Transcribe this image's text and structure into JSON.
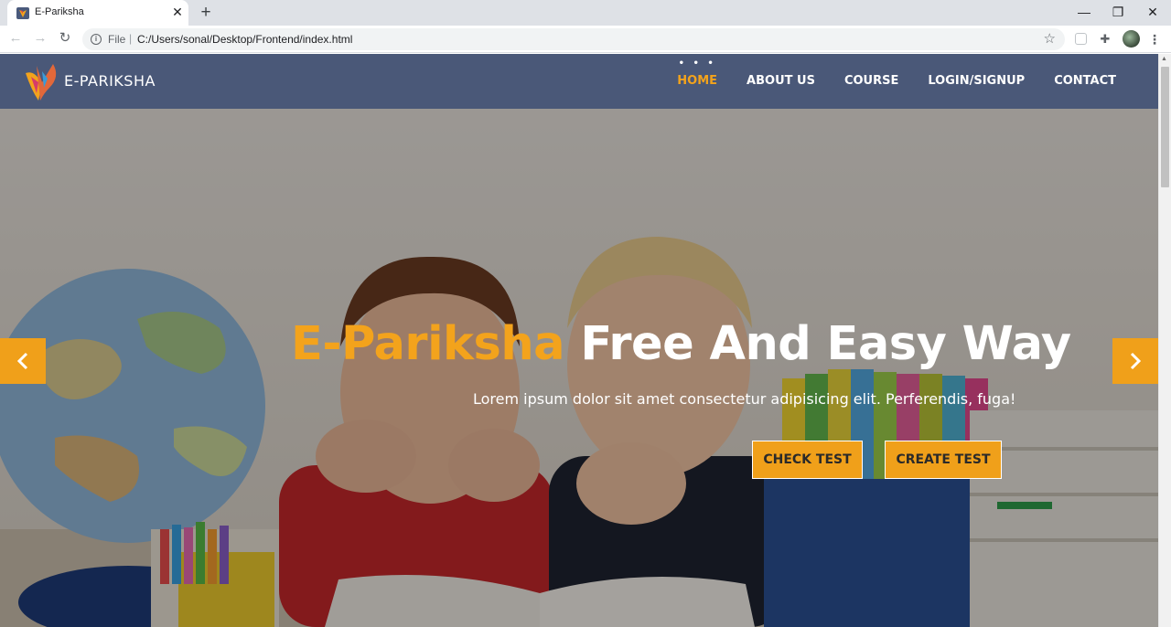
{
  "browser": {
    "tab_title": "E-Pariksha",
    "tab_close": "✕",
    "new_tab": "+",
    "window_controls": {
      "minimize": "—",
      "maximize": "❐",
      "close": "✕"
    },
    "address": {
      "scheme": "File",
      "separator": "|",
      "url": "C:/Users/sonal/Desktop/Frontend/index.html"
    },
    "icons": {
      "back": "arrow-left-icon",
      "forward": "arrow-right-icon",
      "reload": "reload-icon",
      "info": "info-icon",
      "bookmark": "star-icon",
      "extensions": "puzzle-icon",
      "menu": "menu-dots-icon"
    }
  },
  "site": {
    "logo_text": "E-PARIKSHA",
    "nav": [
      {
        "label": "HOME",
        "active": true
      },
      {
        "label": "ABOUT US",
        "active": false
      },
      {
        "label": "COURSE",
        "active": false
      },
      {
        "label": "LOGIN/SIGNUP",
        "active": false
      },
      {
        "label": "CONTACT",
        "active": false
      }
    ],
    "active_marker": "• • •"
  },
  "hero": {
    "title_brand": "E-Pariksha",
    "title_rest": "Free And Easy Way",
    "subtitle": "Lorem ipsum dolor sit amet consectetur adipisicing elit. Perferendis, fuga!",
    "buttons": {
      "check": "CHECK TEST",
      "create": "CREATE TEST"
    },
    "carousel": {
      "prev_icon": "chevron-left-icon",
      "next_icon": "chevron-right-icon"
    }
  },
  "colors": {
    "nav_bg": "#4a5878",
    "accent": "#f3a31c",
    "button_bg": "#f0a01a"
  }
}
